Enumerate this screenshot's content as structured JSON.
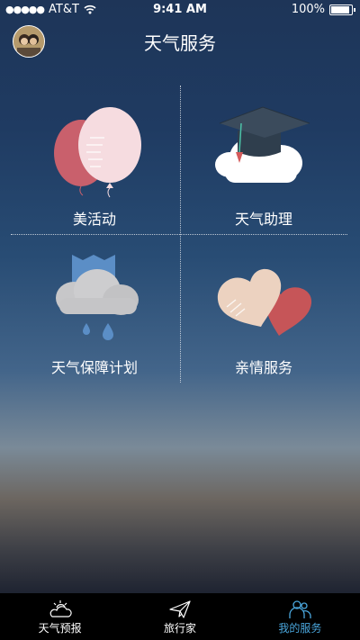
{
  "status_bar": {
    "carrier": "AT&T",
    "time": "9:41 AM",
    "battery": "100%",
    "battery_level": 1.0
  },
  "nav": {
    "title": "天气服务"
  },
  "services": [
    {
      "label": "美活动",
      "icon": "balloons-icon"
    },
    {
      "label": "天气助理",
      "icon": "graduation-cap-cloud-icon"
    },
    {
      "label": "天气保障计划",
      "icon": "rain-cloud-umbrella-icon"
    },
    {
      "label": "亲情服务",
      "icon": "hearts-icon"
    }
  ],
  "tabs": [
    {
      "label": "天气预报",
      "icon": "sun-cloud-icon",
      "active": false
    },
    {
      "label": "旅行家",
      "icon": "paper-plane-icon",
      "active": false
    },
    {
      "label": "我的服务",
      "icon": "people-icon",
      "active": true
    }
  ],
  "colors": {
    "accent": "#4aa6dc",
    "tab_bar": "#000000"
  }
}
